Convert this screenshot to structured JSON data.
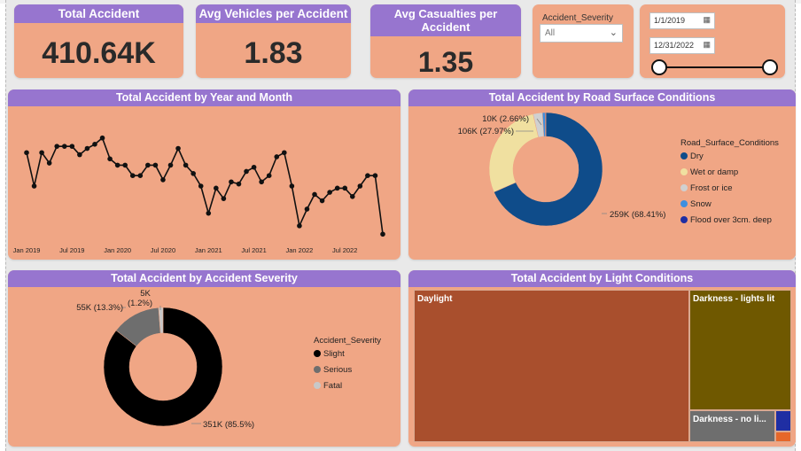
{
  "kpis": {
    "total_accident": {
      "title": "Total Accident",
      "value": "410.64K"
    },
    "avg_vehicles": {
      "title": "Avg Vehicles per Accident",
      "value": "1.83"
    },
    "avg_casualties": {
      "title": "Avg Casualties per Accident",
      "value": "1.35"
    }
  },
  "severity_slicer": {
    "label": "Accident_Severity",
    "selected": "All"
  },
  "date_slicer": {
    "start": "1/1/2019",
    "end": "12/31/2022"
  },
  "line_panel": {
    "title": "Total Accident by Year and Month",
    "x_tick_labels": [
      "Jan 2019",
      "Jul 2019",
      "Jan 2020",
      "Jul 2020",
      "Jan 2021",
      "Jul 2021",
      "Jan 2022",
      "Jul 2022"
    ]
  },
  "road_panel": {
    "title": "Total Accident by Road Surface Conditions",
    "legend_title": "Road_Surface_Conditions",
    "legend": [
      "Dry",
      "Wet or damp",
      "Frost or ice",
      "Snow",
      "Flood over 3cm. deep"
    ],
    "labels": {
      "dry": "259K (68.41%)",
      "wet": "106K (27.97%)",
      "frost": "10K (2.66%)"
    }
  },
  "severity_panel": {
    "title": "Total Accident by Accident Severity",
    "legend_title": "Accident_Severity",
    "legend": [
      "Slight",
      "Serious",
      "Fatal"
    ],
    "labels": {
      "slight": "351K (85.5%)",
      "serious": "55K (13.3%)",
      "fatal_top": "5K",
      "fatal_bottom": "(1.2%)"
    }
  },
  "light_panel": {
    "title": "Total Accident by Light Conditions",
    "tiles": {
      "daylight": "Daylight",
      "dark_lit": "Darkness - lights lit",
      "dark_nolight": "Darkness - no li..."
    }
  },
  "colors": {
    "card": "#f0a685",
    "header": "#9775cf",
    "dry": "#0f4c8a",
    "wet": "#f0e0a0",
    "frost": "#d0d0d0",
    "snow": "#3d8fe0",
    "flood": "#1f2ea3",
    "slight": "#000000",
    "serious": "#6e6e6e",
    "fatal": "#c8c8c8",
    "daylight": "#a94f2d",
    "dark_lit": "#6f5800",
    "dark_nolight": "#6e6e6e"
  },
  "chart_data": [
    {
      "type": "line",
      "title": "Total Accident by Year and Month",
      "x": [
        "2019-01",
        "2019-02",
        "2019-03",
        "2019-04",
        "2019-05",
        "2019-06",
        "2019-07",
        "2019-08",
        "2019-09",
        "2019-10",
        "2019-11",
        "2019-12",
        "2020-01",
        "2020-02",
        "2020-03",
        "2020-04",
        "2020-05",
        "2020-06",
        "2020-07",
        "2020-08",
        "2020-09",
        "2020-10",
        "2020-11",
        "2020-12",
        "2021-01",
        "2021-02",
        "2021-03",
        "2021-04",
        "2021-05",
        "2021-06",
        "2021-07",
        "2021-08",
        "2021-09",
        "2021-10",
        "2021-11",
        "2021-12",
        "2022-01",
        "2022-02",
        "2022-03",
        "2022-04",
        "2022-05",
        "2022-06",
        "2022-07",
        "2022-08",
        "2022-09",
        "2022-10",
        "2022-11",
        "2022-12"
      ],
      "y": [
        9.9,
        8.3,
        9.9,
        9.4,
        10.2,
        10.2,
        10.2,
        9.8,
        10.1,
        10.3,
        10.6,
        9.6,
        9.3,
        9.3,
        8.8,
        8.8,
        9.3,
        9.3,
        8.6,
        9.3,
        10.1,
        9.3,
        8.9,
        8.3,
        7.0,
        8.2,
        7.7,
        8.5,
        8.4,
        9.0,
        9.2,
        8.5,
        8.8,
        9.7,
        9.9,
        8.3,
        6.4,
        7.2,
        7.9,
        7.6,
        8.0,
        8.2,
        8.2,
        7.8,
        8.3,
        8.8,
        8.8,
        6.0
      ]
    },
    {
      "type": "pie",
      "title": "Total Accident by Road Surface Conditions",
      "categories": [
        "Dry",
        "Wet or damp",
        "Frost or ice",
        "Snow",
        "Flood over 3cm. deep"
      ],
      "values": [
        68.41,
        27.97,
        2.66,
        0.76,
        0.2
      ]
    },
    {
      "type": "pie",
      "title": "Total Accident by Accident Severity",
      "categories": [
        "Slight",
        "Serious",
        "Fatal"
      ],
      "values": [
        85.5,
        13.3,
        1.2
      ]
    },
    {
      "type": "heatmap",
      "title": "Total Accident by Light Conditions",
      "categories": [
        "Daylight",
        "Darkness - lights lit",
        "Darkness - no li...",
        "Other 1",
        "Other 2"
      ],
      "values": [
        73.9,
        19.0,
        5.6,
        0.8,
        0.7
      ]
    }
  ]
}
